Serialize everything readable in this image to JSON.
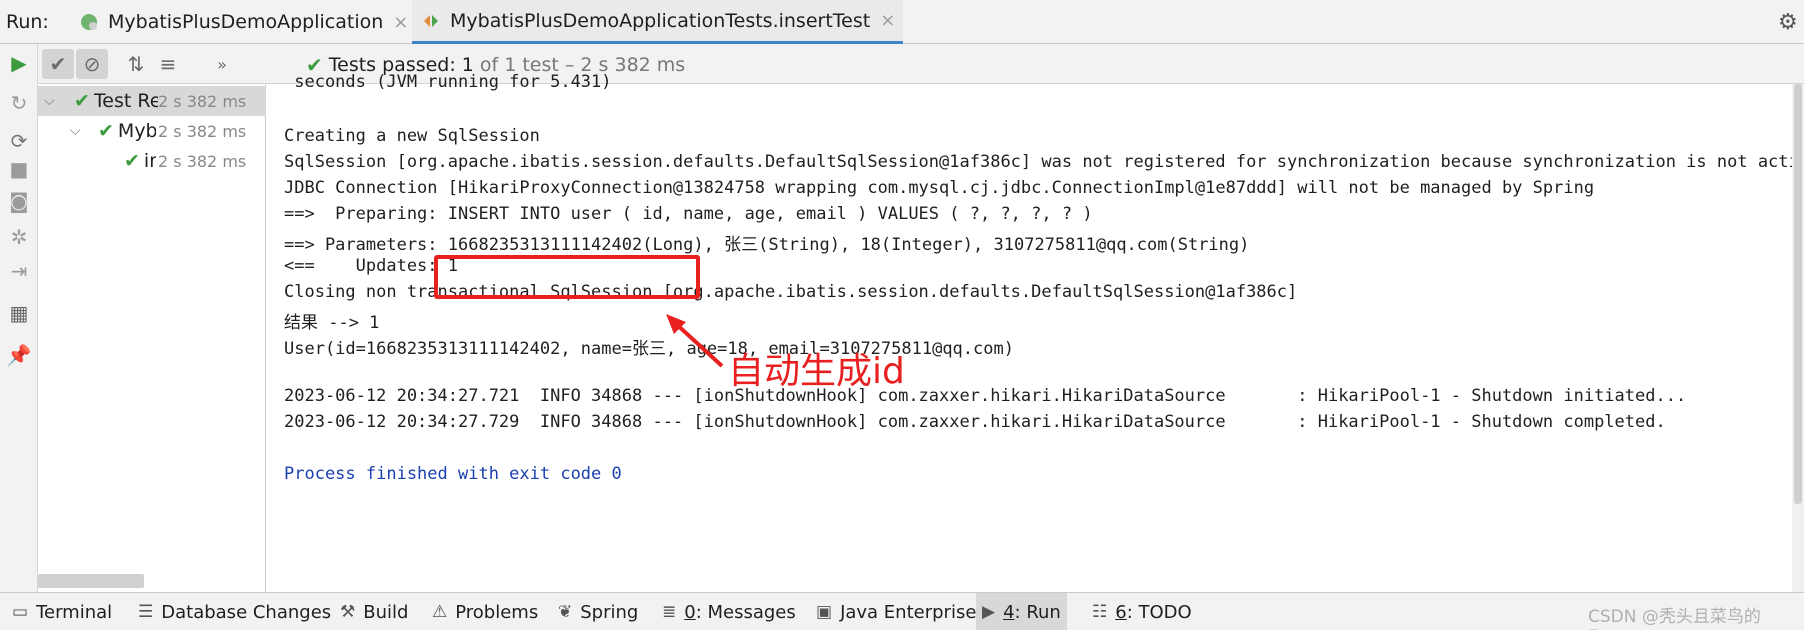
{
  "header": {
    "run_label": "Run:",
    "tabs": [
      {
        "label": "MybatisPlusDemoApplication",
        "icon": "spring-boot-icon"
      },
      {
        "label": "MybatisPlusDemoApplicationTests.insertTest",
        "icon": "test-config-icon"
      }
    ],
    "close_glyph": "×"
  },
  "toolbar": {
    "status_passed": "Tests passed:",
    "status_count": "1",
    "status_rest": "of 1 test – 2 s 382 ms"
  },
  "tree": {
    "rows": [
      {
        "label": "Test Results",
        "time": "2 s 382 ms"
      },
      {
        "label": "MybatisPlusDemoApplicationTests",
        "time": "2 s 382 ms"
      },
      {
        "label": "insertTest",
        "time": "2 s 382 ms"
      }
    ]
  },
  "console": {
    "lines": [
      " seconds (JVM running for 5.431)",
      "",
      "Creating a new SqlSession",
      "SqlSession [org.apache.ibatis.session.defaults.DefaultSqlSession@1af386c] was not registered for synchronization because synchronization is not active",
      "JDBC Connection [HikariProxyConnection@13824758 wrapping com.mysql.cj.jdbc.ConnectionImpl@1e87ddd] will not be managed by Spring",
      "==>  Preparing: INSERT INTO user ( id, name, age, email ) VALUES ( ?, ?, ?, ? )",
      "==> Parameters: 1668235313111142402(Long), 张三(String), 18(Integer), 3107275811@qq.com(String)",
      "<==    Updates: 1",
      "Closing non transactional SqlSession [org.apache.ibatis.session.defaults.DefaultSqlSession@1af386c]",
      "结果 --> 1",
      "User(id=1668235313111142402, name=张三, age=18, email=3107275811@qq.com)",
      "",
      "2023-06-12 20:34:27.721  INFO 34868 --- [ionShutdownHook] com.zaxxer.hikari.HikariDataSource       : HikariPool-1 - Shutdown initiated...",
      "2023-06-12 20:34:27.729  INFO 34868 --- [ionShutdownHook] com.zaxxer.hikari.HikariDataSource       : HikariPool-1 - Shutdown completed.",
      "",
      "Process finished with exit code 0"
    ],
    "annotation": "自动生成id",
    "annotation_color": "#e8201f"
  },
  "bottom_bar": {
    "items": [
      {
        "label": "Terminal",
        "icon": "terminal-icon"
      },
      {
        "label": "Database Changes",
        "icon": "database-icon"
      },
      {
        "label": "Build",
        "icon": "hammer-icon"
      },
      {
        "label": "Problems",
        "icon": "warning-icon"
      },
      {
        "label": "Spring",
        "icon": "spring-leaf-icon"
      },
      {
        "label_num": "0",
        "label": ": Messages",
        "icon": "messages-icon"
      },
      {
        "label": "Java Enterprise",
        "icon": "java-enterprise-icon"
      },
      {
        "label_num": "4",
        "label": ": Run",
        "icon": "run-icon"
      },
      {
        "label_num": "6",
        "label": ": TODO",
        "icon": "todo-icon"
      }
    ],
    "watermark": "CSDN @秃头且菜鸟的Event"
  },
  "colors": {
    "accent": "#4083c9",
    "pass": "#3d9b3d",
    "exit_text": "#1a3fb0"
  }
}
